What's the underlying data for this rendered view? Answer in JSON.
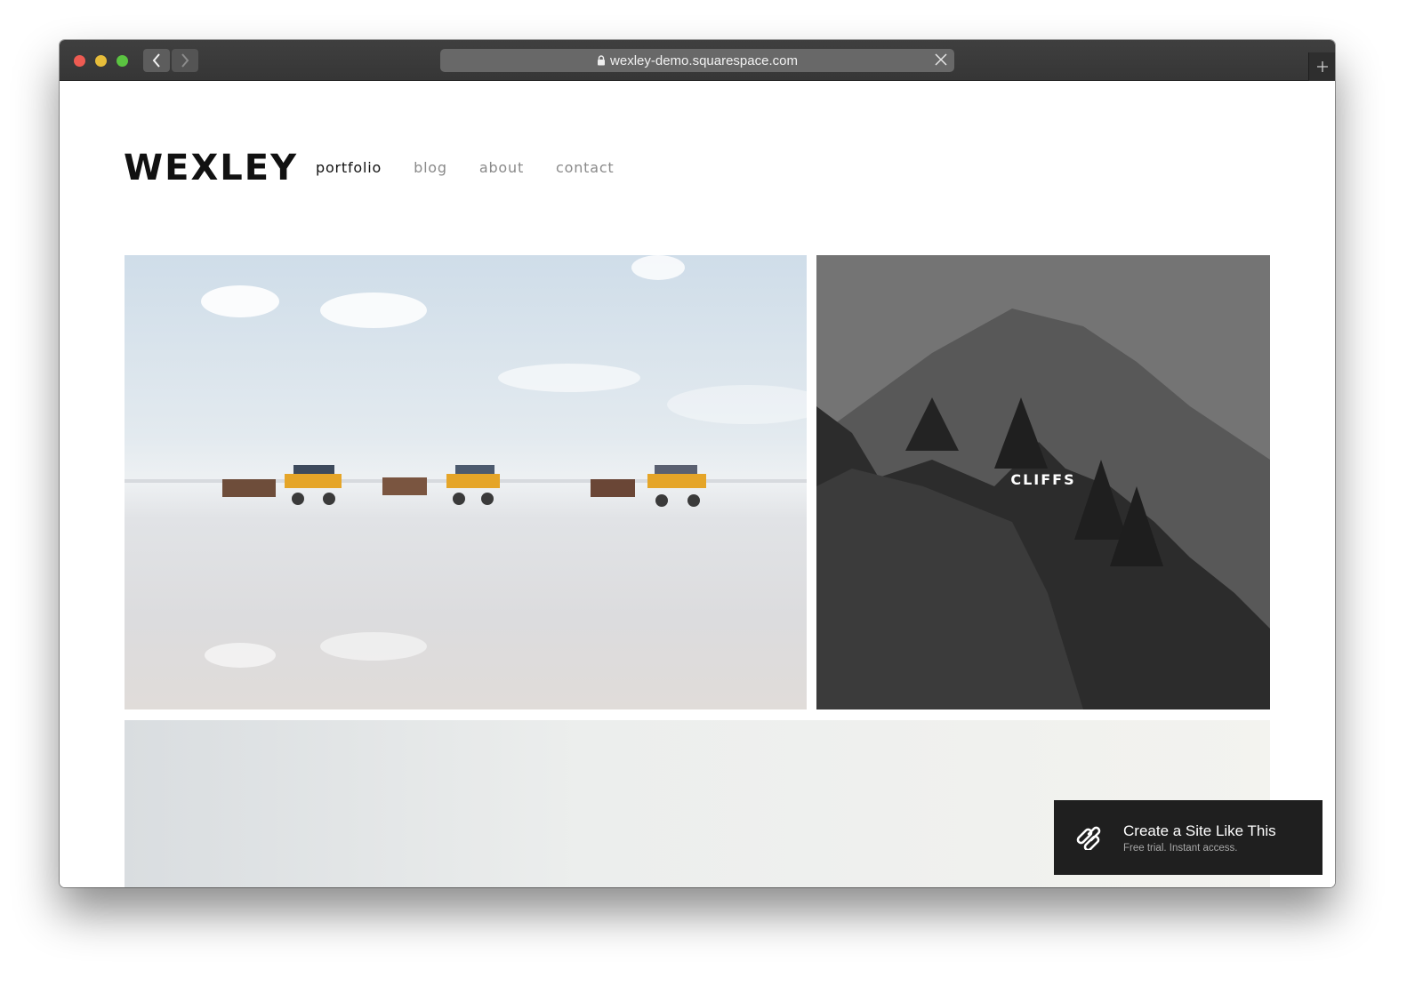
{
  "browser": {
    "url": "wexley-demo.squarespace.com",
    "icons": {
      "back": "chevron-left-icon",
      "forward": "chevron-right-icon",
      "lock": "lock-icon",
      "close": "close-icon",
      "new_tab": "plus-icon"
    }
  },
  "site": {
    "logo": "WEXLEY",
    "nav": [
      {
        "label": "portfolio",
        "active": true
      },
      {
        "label": "blog",
        "active": false
      },
      {
        "label": "about",
        "active": false
      },
      {
        "label": "contact",
        "active": false
      }
    ]
  },
  "gallery": {
    "tiles": [
      {
        "subject": "horse-drawn carriages on tidal flats",
        "caption": ""
      },
      {
        "subject": "black and white mountain cliffs with pine trees",
        "caption": "CLIFFS"
      },
      {
        "subject": "pale misty landscape",
        "caption": ""
      }
    ]
  },
  "cta": {
    "title": "Create a Site Like This",
    "subtitle": "Free trial. Instant access.",
    "icon": "squarespace-logo-icon"
  },
  "colors": {
    "titlebar": "#3a3a3a",
    "nav_active": "#111111",
    "nav_inactive": "#8a8a8a",
    "cta_bg": "#1f1f1f"
  }
}
